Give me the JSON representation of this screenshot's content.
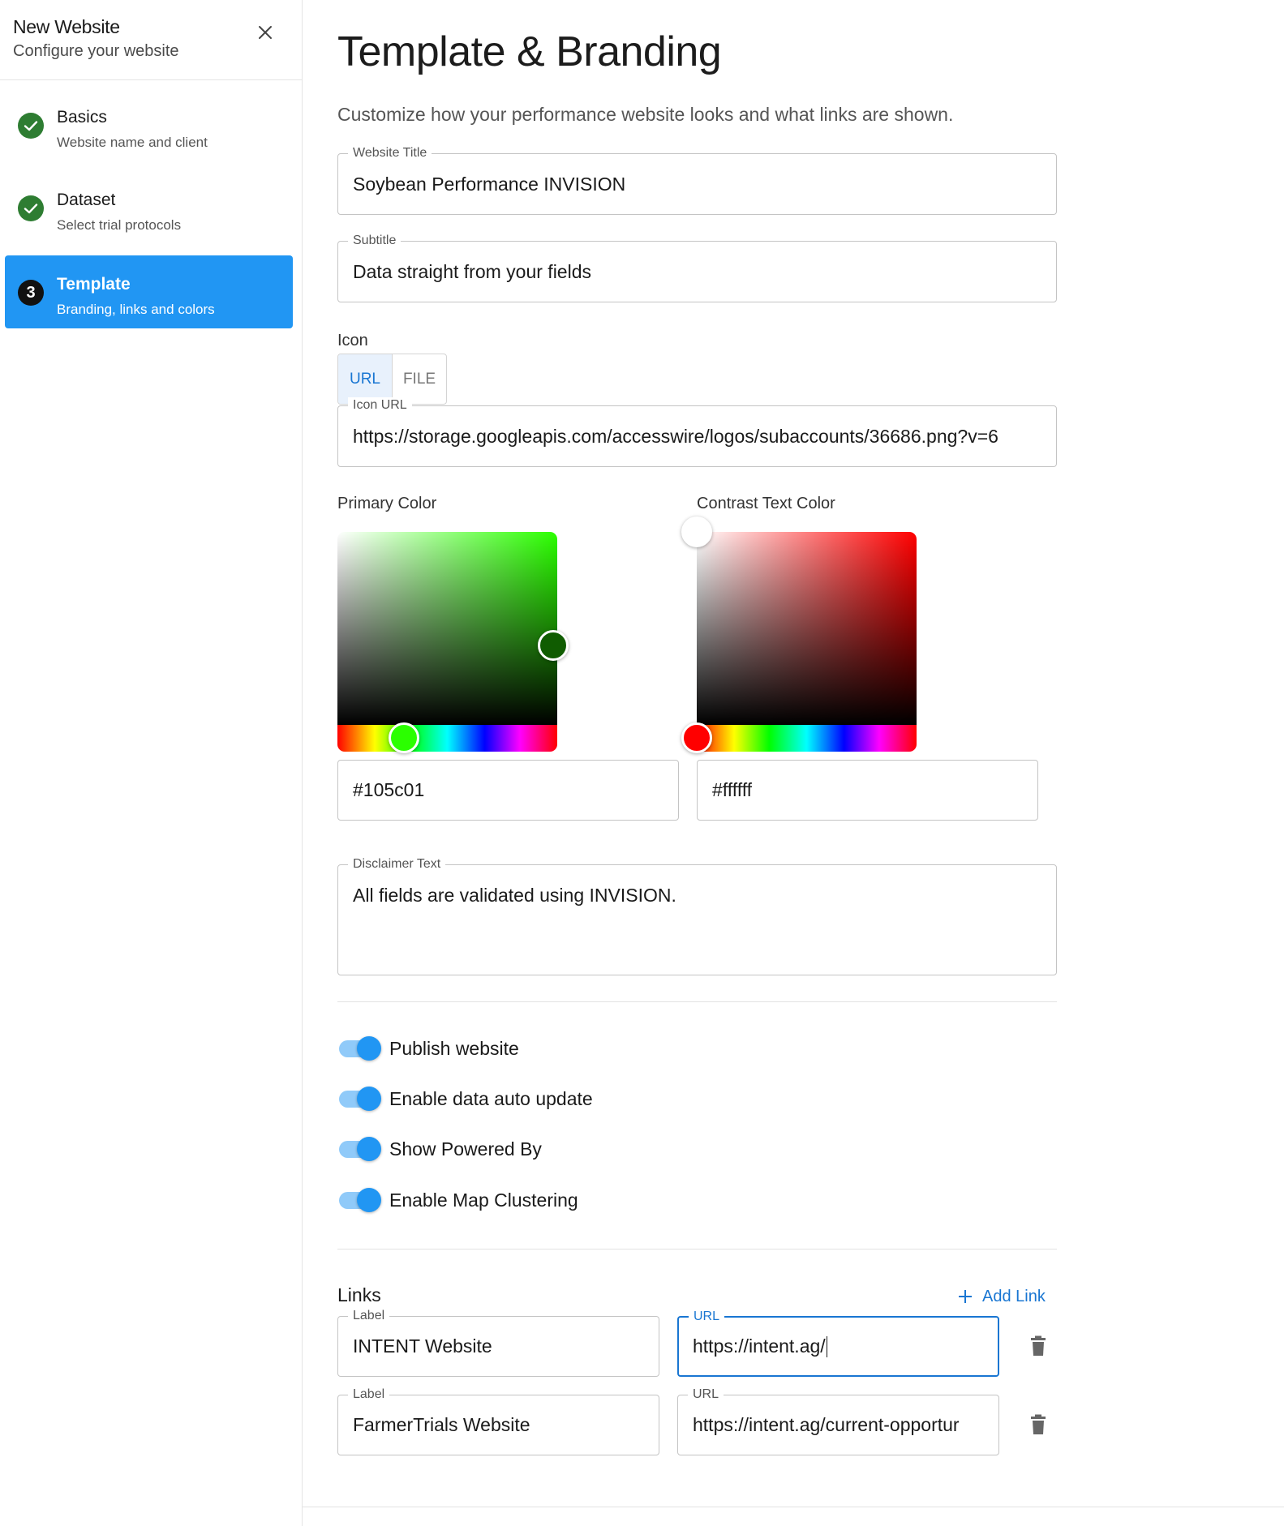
{
  "sidebar": {
    "title": "New Website",
    "subtitle": "Configure your website",
    "close_icon": "close-icon",
    "steps": [
      {
        "title": "Basics",
        "subtitle": "Website name and client",
        "state": "done",
        "icon": "check-icon"
      },
      {
        "title": "Dataset",
        "subtitle": "Select trial protocols",
        "state": "done",
        "icon": "check-icon"
      },
      {
        "title": "Template",
        "subtitle": "Branding, links and colors",
        "state": "active",
        "number": "3"
      }
    ]
  },
  "main": {
    "title": "Template & Branding",
    "description": "Customize how your performance website looks and what links are shown.",
    "website_title": {
      "label": "Website Title",
      "value": "Soybean Performance INVISION"
    },
    "subtitle": {
      "label": "Subtitle",
      "value": "Data straight from your fields"
    },
    "icon": {
      "label": "Icon",
      "tabs": [
        "URL",
        "FILE"
      ],
      "selected_tab": "URL",
      "url_label": "Icon URL",
      "url_value": "https://storage.googleapis.com/accesswire/logos/subaccounts/36686.png?v=6"
    },
    "primary_color": {
      "label": "Primary Color",
      "value": "#105c01",
      "hue_color": "#2bff00"
    },
    "contrast_color": {
      "label": "Contrast Text Color",
      "value": "#ffffff",
      "hue_color": "#ff0000"
    },
    "disclaimer": {
      "label": "Disclaimer Text",
      "value": "All fields are validated using INVISION."
    },
    "toggles": [
      {
        "label": "Publish website",
        "on": true
      },
      {
        "label": "Enable data auto update",
        "on": true
      },
      {
        "label": "Show Powered By",
        "on": true
      },
      {
        "label": "Enable Map Clustering",
        "on": true
      }
    ],
    "links": {
      "title": "Links",
      "add_label": "Add Link",
      "rows": [
        {
          "label_caption": "Label",
          "label_value": "INTENT Website",
          "url_caption": "URL",
          "url_value": "https://intent.ag/"
        },
        {
          "label_caption": "Label",
          "label_value": "FarmerTrials Website",
          "url_caption": "URL",
          "url_value": "https://intent.ag/current-opportur"
        }
      ]
    }
  },
  "colors": {
    "accent": "#2196f3",
    "success": "#2e7d32",
    "focus": "#1976d2"
  }
}
